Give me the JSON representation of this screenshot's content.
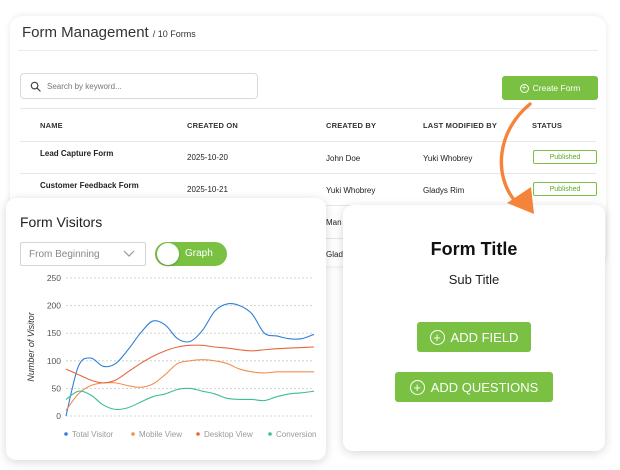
{
  "management": {
    "title": "Form Management",
    "count": "/ 10 Forms",
    "search_placeholder": "Search by keyword...",
    "create_label": "Create Form",
    "columns": [
      "NAME",
      "CREATED ON",
      "CREATED BY",
      "LAST MODIFIED BY",
      "STATUS"
    ],
    "rows": [
      {
        "name": "Lead Capture Form",
        "created_on": "2025-10-20",
        "created_by": "John Doe",
        "modified_by": "Yuki Whobrey",
        "status": "Published"
      },
      {
        "name": "Customer Feedback Form",
        "created_on": "2025-10-21",
        "created_by": "Yuki Whobrey",
        "modified_by": "Gladys Rim",
        "status": "Published"
      }
    ],
    "partial_cells": [
      "Man",
      "Glad"
    ]
  },
  "visitors": {
    "title": "Form Visitors",
    "range_value": "From Beginning",
    "toggle_label": "Graph"
  },
  "form_card": {
    "title": "Form Title",
    "subtitle": "Sub Title",
    "add_field_label": "ADD FIELD",
    "add_questions_label": "ADD QUESTIONS"
  },
  "colors": {
    "accent_green": "#7ac143",
    "arrow_orange": "#f5833a"
  },
  "chart_data": {
    "type": "line",
    "ylabel": "Number of Visitor",
    "xlabel": "",
    "ylim": [
      0,
      250
    ],
    "yticks": [
      0,
      50,
      100,
      150,
      200,
      250
    ],
    "grid": true,
    "legend_position": "bottom",
    "x": [
      0,
      1,
      2,
      3,
      4,
      5,
      6,
      7,
      8,
      9,
      10,
      11,
      12,
      13,
      14,
      15,
      16,
      17,
      18,
      19,
      20
    ],
    "series": [
      {
        "name": "Total Visitor",
        "color": "#2f80d8",
        "values": [
          0,
          90,
          105,
          90,
          95,
          120,
          150,
          172,
          165,
          140,
          135,
          155,
          190,
          203,
          200,
          185,
          150,
          145,
          140,
          140,
          148
        ]
      },
      {
        "name": "Mobile View",
        "color": "#f28e4f",
        "values": [
          10,
          40,
          55,
          60,
          60,
          55,
          52,
          58,
          75,
          95,
          100,
          102,
          100,
          95,
          85,
          80,
          78,
          80,
          80,
          80,
          80
        ]
      },
      {
        "name": "Desktop View",
        "color": "#e5673a",
        "values": [
          85,
          75,
          65,
          60,
          65,
          80,
          95,
          108,
          118,
          125,
          128,
          128,
          125,
          123,
          120,
          118,
          120,
          122,
          123,
          124,
          125
        ]
      },
      {
        "name": "Conversion",
        "color": "#3dbf8f",
        "values": [
          30,
          45,
          38,
          20,
          12,
          15,
          25,
          35,
          40,
          48,
          50,
          45,
          40,
          32,
          30,
          30,
          28,
          35,
          40,
          42,
          45
        ]
      }
    ]
  }
}
